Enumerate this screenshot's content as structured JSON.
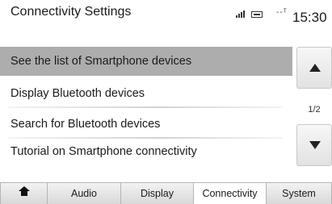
{
  "header": {
    "title": "Connectivity Settings",
    "status_text": "--ᵀ",
    "clock": "15:30"
  },
  "list": {
    "items": [
      {
        "label": "See the list of Smartphone devices",
        "selected": true
      },
      {
        "label": "Display Bluetooth devices",
        "selected": false
      },
      {
        "label": "Search for Bluetooth devices",
        "selected": false
      },
      {
        "label": "Tutorial on Smartphone connectivity",
        "selected": false
      }
    ]
  },
  "scroll": {
    "page_indicator": "1/2"
  },
  "tabs": [
    {
      "label": "",
      "icon": "home-icon",
      "active": false
    },
    {
      "label": "Audio",
      "active": false
    },
    {
      "label": "Display",
      "active": false
    },
    {
      "label": "Connectivity",
      "active": true
    },
    {
      "label": "System",
      "active": false
    }
  ]
}
